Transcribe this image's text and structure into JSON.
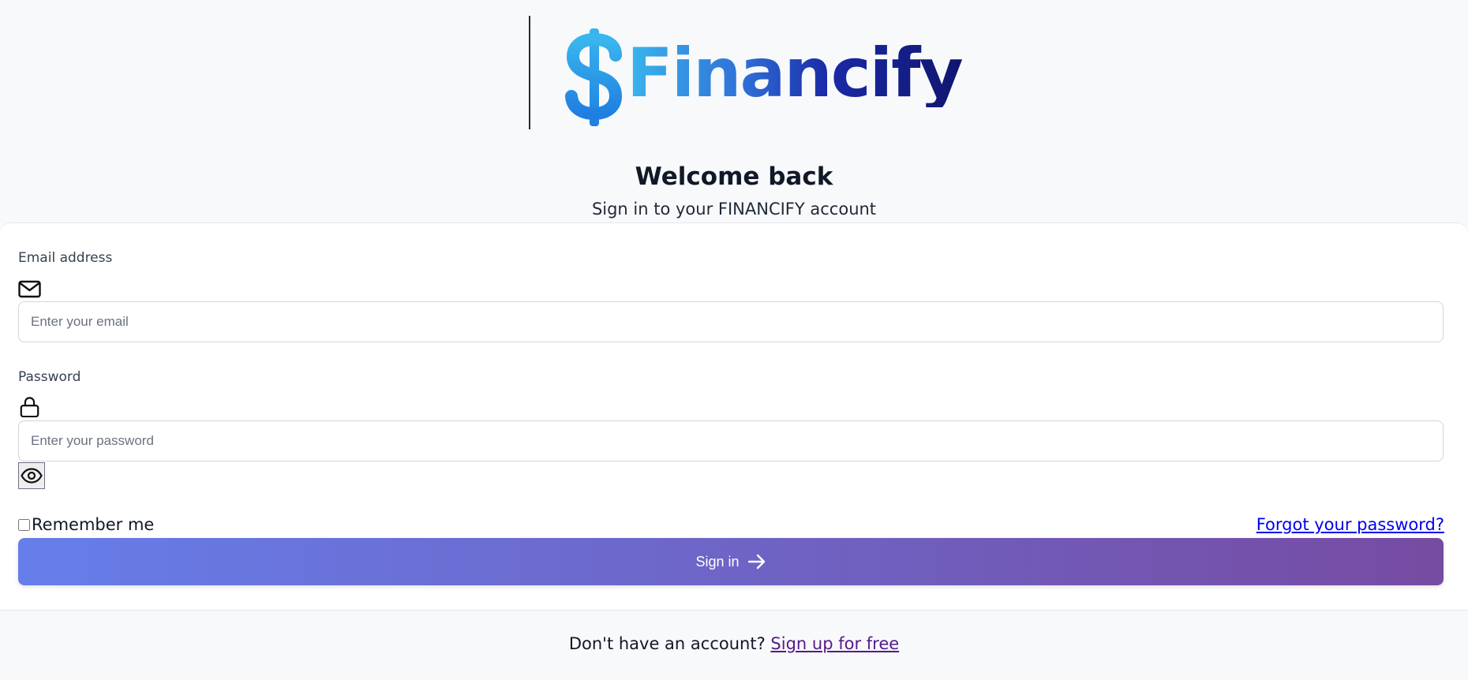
{
  "brand": {
    "name": "Financify",
    "logo_symbol": "dollar-sign-icon",
    "colors": {
      "light_blue": "#3ab6ee",
      "mid_blue": "#2f6fd6",
      "navy": "#10156e"
    }
  },
  "header": {
    "title": "Welcome back",
    "subtitle": "Sign in to your FINANCIFY account"
  },
  "form": {
    "email": {
      "label": "Email address",
      "icon": "mail-icon",
      "placeholder": "Enter your email",
      "value": ""
    },
    "password": {
      "label": "Password",
      "icon": "lock-icon",
      "placeholder": "Enter your password",
      "value": "",
      "toggle_icon": "eye-icon"
    },
    "remember_label": "Remember me",
    "remember_checked": false,
    "forgot_label": "Forgot your password?",
    "submit_label": "Sign in",
    "submit_icon": "arrow-right-icon",
    "button_gradient": [
      "#667eea",
      "#764ba2"
    ]
  },
  "footer": {
    "prompt": "Don't have an account?",
    "signup_label": "Sign up for free"
  }
}
